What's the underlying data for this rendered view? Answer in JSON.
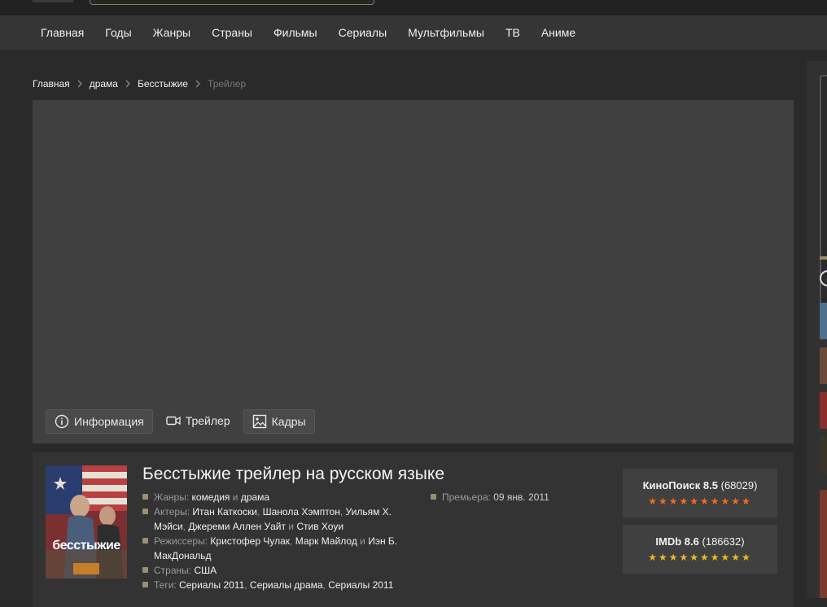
{
  "nav": {
    "items": [
      "Главная",
      "Годы",
      "Жанры",
      "Страны",
      "Фильмы",
      "Сериалы",
      "Мультфильмы",
      "ТВ",
      "Аниме"
    ]
  },
  "breadcrumb": {
    "items": [
      "Главная",
      "драма",
      "Бесстыжие"
    ],
    "current": "Трейлер"
  },
  "player": {
    "tabs": {
      "info": "Информация",
      "trailer": "Трейлер",
      "frames": "Кадры"
    }
  },
  "movie": {
    "title": "Бесстыжие трейлер на русском языке",
    "poster_text": "бесстыжие",
    "genres_label": "Жанры:",
    "genres": [
      "комедия",
      "драма"
    ],
    "actors_label": "Актеры:",
    "actors": [
      "Итан Каткоски",
      "Шанола Хэмптон",
      "Уильям Х. Мэйси",
      "Джереми Аллен Уайт",
      "Стив Хоуи"
    ],
    "directors_label": "Режиссеры:",
    "directors": [
      "Кристофер Чулак",
      "Марк Майлод",
      "Иэн Б. МакДональд"
    ],
    "countries_label": "Страны:",
    "countries": [
      "США"
    ],
    "tags_label": "Теги:",
    "tags": [
      "Сериалы 2011",
      "Сериалы драма",
      "Сериалы 2011"
    ],
    "premiere_label": "Премьера:",
    "premiere": "09 янв. 2011",
    "conj_and": "и"
  },
  "ratings": {
    "kinopoisk": {
      "label": "КиноПоиск 8.5",
      "votes": "(68029)",
      "stars": 10,
      "color": "#f26b1d"
    },
    "imdb": {
      "label": "IMDb 8.6",
      "votes": "(186632)",
      "stars": 10,
      "color": "#e8b923"
    }
  }
}
